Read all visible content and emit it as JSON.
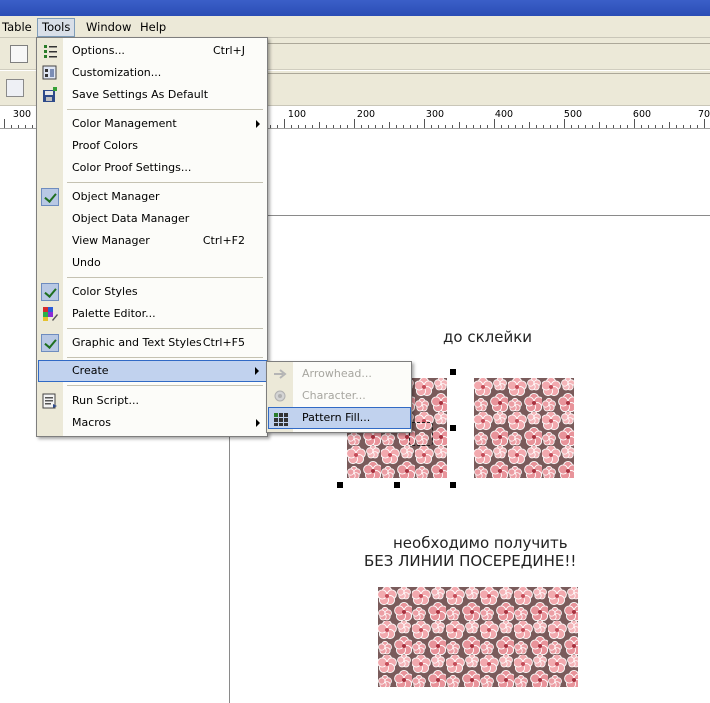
{
  "menubar": {
    "items": [
      {
        "label": "Table"
      },
      {
        "label": "Tools"
      },
      {
        "label": "Window"
      },
      {
        "label": "Help"
      }
    ]
  },
  "ruler": {
    "labels": [
      "300",
      "100",
      "200",
      "300",
      "400",
      "500",
      "600",
      "70"
    ]
  },
  "tools_menu": {
    "items": [
      {
        "label": "Options...",
        "shortcut": "Ctrl+J",
        "icon": "options-icon"
      },
      {
        "label": "Customization...",
        "icon": "customization-icon"
      },
      {
        "label": "Save Settings As Default",
        "icon": "save-settings-icon"
      },
      {
        "label": "Color Management",
        "submenu": true
      },
      {
        "label": "Proof Colors"
      },
      {
        "label": "Color Proof Settings..."
      },
      {
        "label": "Object Manager",
        "checked": true
      },
      {
        "label": "Object Data Manager"
      },
      {
        "label": "View Manager",
        "shortcut": "Ctrl+F2"
      },
      {
        "label": "Undo"
      },
      {
        "label": "Color Styles",
        "checked": true
      },
      {
        "label": "Palette Editor...",
        "icon": "palette-icon"
      },
      {
        "label": "Graphic and Text Styles",
        "shortcut": "Ctrl+F5",
        "checked": true
      },
      {
        "label": "Create",
        "submenu": true,
        "highlighted": true
      },
      {
        "label": "Run Script...",
        "icon": "script-icon"
      },
      {
        "label": "Macros",
        "submenu": true
      }
    ]
  },
  "create_submenu": {
    "items": [
      {
        "label": "Arrowhead...",
        "disabled": true
      },
      {
        "label": "Character...",
        "disabled": true
      },
      {
        "label": "Pattern Fill...",
        "highlighted": true
      }
    ]
  },
  "canvas": {
    "caption_before": "до склейки",
    "caption_goal_line1": "необходимо получить",
    "caption_goal_line2": "БЕЗ ЛИНИИ ПОСЕРЕДИНЕ!!"
  },
  "colors": {
    "menu_highlight": "#c1d2ee",
    "menu_highlight_border": "#316ac5",
    "pattern_base": "#e8939a",
    "pattern_dark": "#7a5b5b"
  }
}
